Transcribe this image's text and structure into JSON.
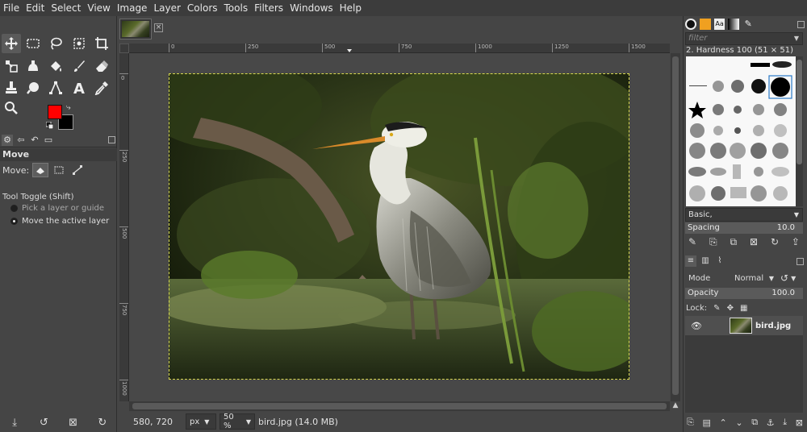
{
  "menubar": {
    "items": [
      "File",
      "Edit",
      "Select",
      "View",
      "Image",
      "Layer",
      "Colors",
      "Tools",
      "Filters",
      "Windows",
      "Help"
    ]
  },
  "colors": {
    "foreground": "#ff0000",
    "background": "#000000"
  },
  "tool_options": {
    "title": "Move",
    "move_label": "Move:",
    "toggle_label": "Tool Toggle  (Shift)",
    "options": [
      "Pick a layer or guide",
      "Move the active layer"
    ],
    "selected_option": 1
  },
  "rulers": {
    "horizontal_labels": [
      "0",
      "250",
      "500",
      "750",
      "1000",
      "1250",
      "1500"
    ],
    "vertical_labels": [
      "0",
      "250",
      "500",
      "750",
      "1000"
    ]
  },
  "status": {
    "coords": "580, 720",
    "unit": "px",
    "zoom": "50 %",
    "file_info": "bird.jpg (14.0 MB)"
  },
  "brushes": {
    "filter_placeholder": "filter",
    "selected_name": "2. Hardness 100 (51 × 51)",
    "set_name": "Basic,",
    "spacing_label": "Spacing",
    "spacing_value": "10.0"
  },
  "layers": {
    "mode_label": "Mode",
    "mode_value": "Normal",
    "opacity_label": "Opacity",
    "opacity_value": "100.0",
    "lock_label": "Lock:",
    "items": [
      {
        "name": "bird.jpg",
        "visible": true
      }
    ]
  }
}
